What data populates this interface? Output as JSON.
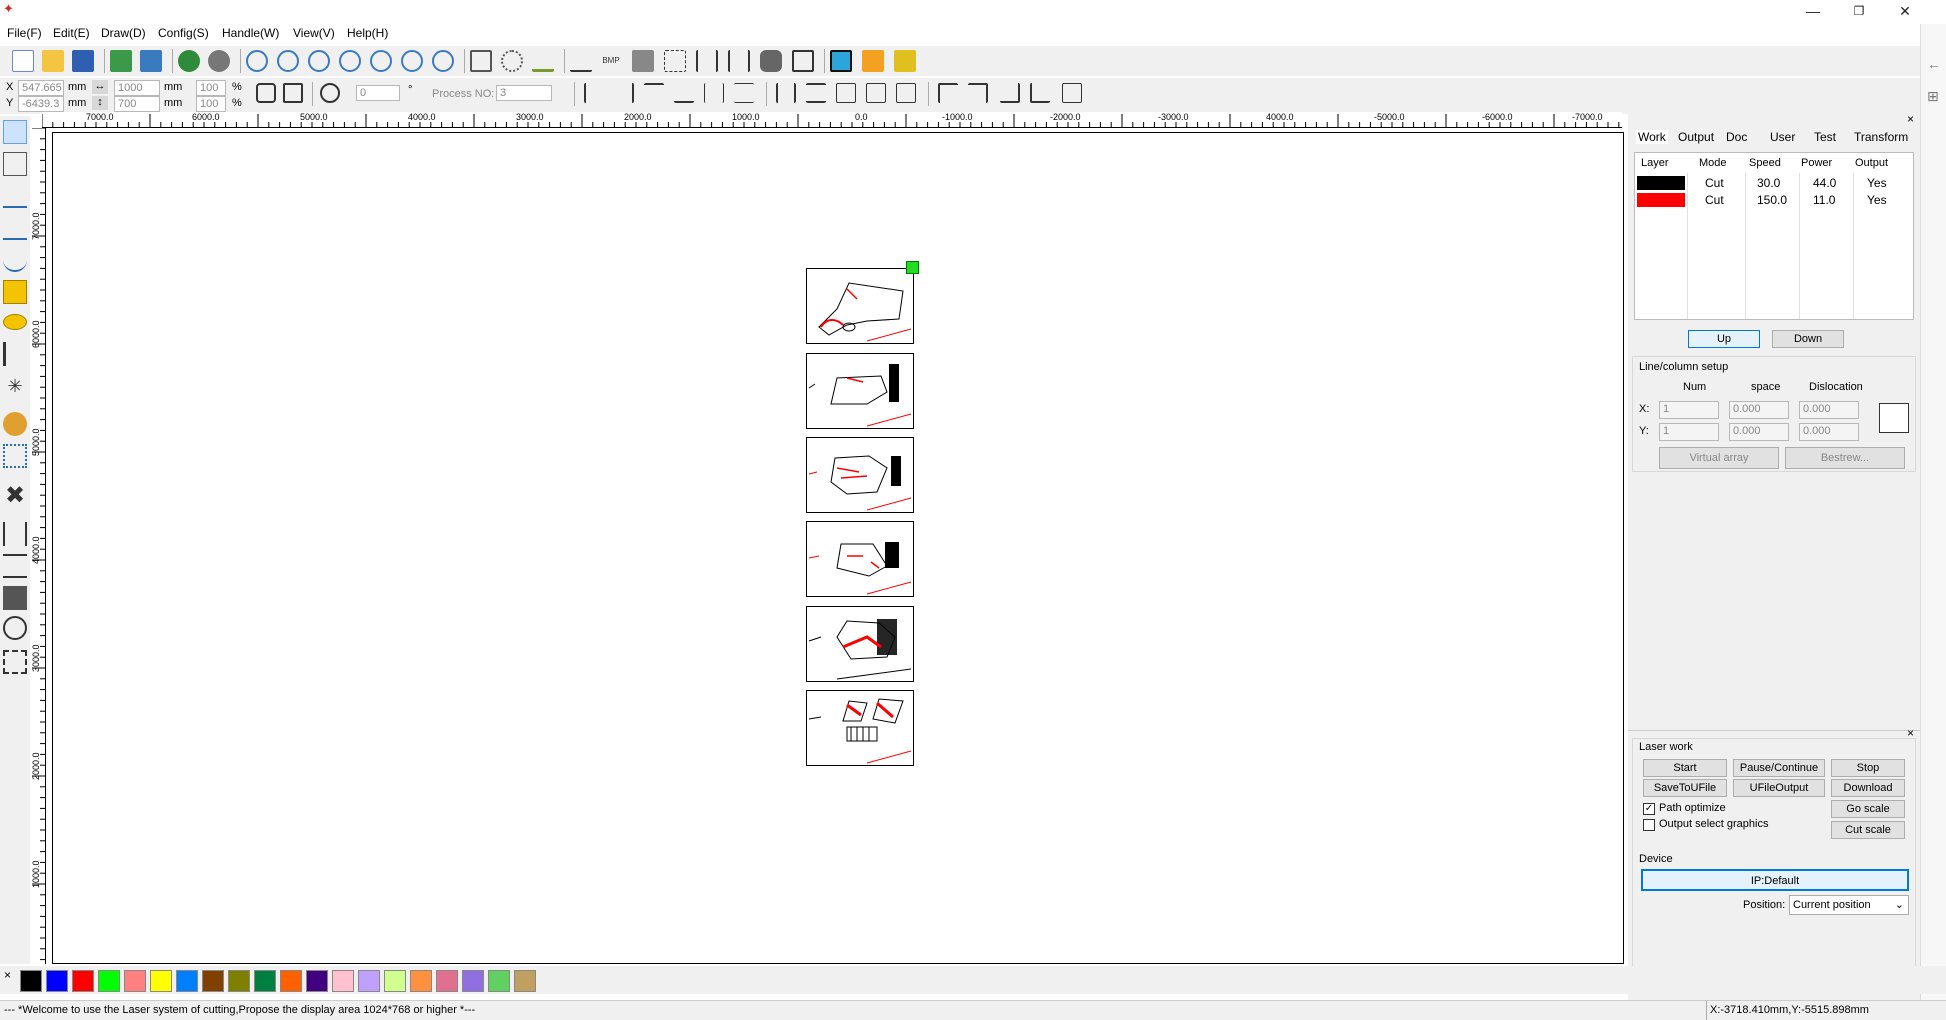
{
  "window": {
    "minimize_glyph": "—",
    "restore_glyph": "❐",
    "close_glyph": "✕"
  },
  "menu": [
    "File(F)",
    "Edit(E)",
    "Draw(D)",
    "Config(S)",
    "Handle(W)",
    "View(V)",
    "Help(H)"
  ],
  "coords": {
    "x_label": "X",
    "y_label": "Y",
    "x_value": "547.665",
    "y_value": "-6439.3",
    "unit": "mm",
    "width_value": "1000",
    "height_value": "700",
    "scale_x": "100",
    "scale_y": "100",
    "percent": "%",
    "rotate_value": "0",
    "degree": "°",
    "process_label": "Process NO:",
    "process_value": "3"
  },
  "hruler_labels": [
    "7000.0",
    "6000.0",
    "5000.0",
    "4000.0",
    "3000.0",
    "2000.0",
    "1000.0",
    "0.0",
    "-1000.0",
    "-2000.0",
    "-3000.0",
    "4000.0",
    "-5000.0",
    "-6000.0",
    "-7000.0"
  ],
  "vruler_labels": [
    "7000.0",
    "6000.0",
    "5000.0",
    "4000.0",
    "3000.0",
    "2000.0",
    "1000.0"
  ],
  "panel": {
    "close_glyph": "×",
    "tabs": [
      "Work",
      "Output",
      "Doc",
      "User",
      "Test",
      "Transform"
    ],
    "layer_headers": [
      "Layer",
      "Mode",
      "Speed",
      "Power",
      "Output"
    ],
    "layers": [
      {
        "color": "#000000",
        "mode": "Cut",
        "speed": "30.0",
        "power": "44.0",
        "output": "Yes"
      },
      {
        "color": "#ff0000",
        "mode": "Cut",
        "speed": "150.0",
        "power": "11.0",
        "output": "Yes"
      }
    ],
    "up_label": "Up",
    "down_label": "Down",
    "linecol_title": "Line/column setup",
    "num_label": "Num",
    "space_label": "space",
    "dislocation_label": "Dislocation",
    "x_label": "X:",
    "y_label": "Y:",
    "x_num": "1",
    "x_space": "0.000",
    "x_disl": "0.000",
    "y_num": "1",
    "y_space": "0.000",
    "y_disl": "0.000",
    "virtual_array_label": "Virtual array",
    "bestrew_label": "Bestrew..."
  },
  "laser": {
    "close_glyph": "×",
    "title": "Laser work",
    "start": "Start",
    "pause": "Pause/Continue",
    "stop": "Stop",
    "save_ufile": "SaveToUFile",
    "ufile_output": "UFileOutput",
    "download": "Download",
    "path_optimize": "Path optimize",
    "output_select": "Output select graphics",
    "go_scale": "Go scale",
    "cut_scale": "Cut scale",
    "device_title": "Device",
    "ip_label": "IP:Default",
    "position_label": "Position:",
    "position_value": "Current position"
  },
  "palette": {
    "close_glyph": "×",
    "colors": [
      "#000000",
      "#0000ff",
      "#ff0000",
      "#00ff00",
      "#ff8080",
      "#ffff00",
      "#0080ff",
      "#804000",
      "#808000",
      "#008040",
      "#ff6000",
      "#400080",
      "#ffc0d0",
      "#c0a0ff",
      "#d0ff90",
      "#ff9040",
      "#e07090",
      "#9070e0",
      "#60d060",
      "#c0a060"
    ]
  },
  "status": {
    "message": "--- *Welcome to use the Laser system of cutting,Propose the display area 1024*768 or higher *---",
    "position": "X:-3718.410mm,Y:-5515.898mm"
  }
}
